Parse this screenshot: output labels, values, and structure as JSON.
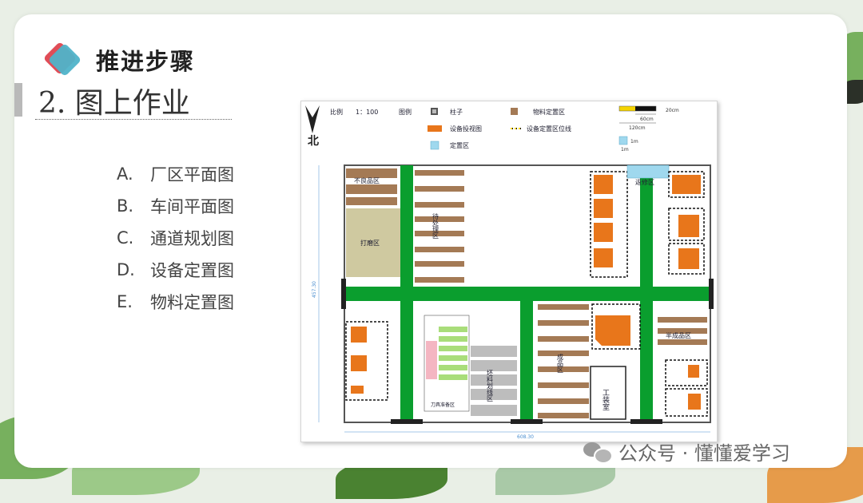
{
  "heading": "推进步骤",
  "subheading": "2. 图上作业",
  "menu": [
    {
      "letter": "A.",
      "label": "厂区平面图"
    },
    {
      "letter": "B.",
      "label": "车间平面图"
    },
    {
      "letter": "C.",
      "label": "通道规划图"
    },
    {
      "letter": "D.",
      "label": "设备定置图"
    },
    {
      "letter": "E.",
      "label": "物料定置图"
    }
  ],
  "plan": {
    "north": "北",
    "scale_label": "比例",
    "scale_value": "1：100",
    "legend_label": "图例",
    "legend_pillar": "柱子",
    "legend_material": "物料定置区",
    "legend_equipment": "设备投视图",
    "legend_equip_line": "设备定置区位线",
    "legend_zone": "定置区",
    "scale_20cm": "20cm",
    "scale_60cm": "60cm",
    "scale_120cm": "120cm",
    "scale_1m_a": "1m",
    "scale_1m_b": "1m",
    "zone_defective": "不良品区",
    "zone_pending": "待处理区",
    "zone_grinding": "打磨区",
    "zone_repair": "返修区",
    "zone_semi": "半成品区",
    "zone_finished": "成品区",
    "zone_blank": "坯料划线区",
    "zone_tool_prep": "刀具准备区",
    "zone_tooling": "工装室",
    "dim_width": "608.30",
    "dim_height": "457.30"
  },
  "watermark": "公众号 · 懂懂爱学习"
}
